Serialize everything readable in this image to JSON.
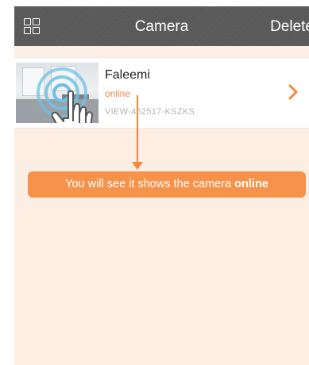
{
  "navbar": {
    "title": "Camera",
    "delete_label": "Delete",
    "menu_icon": "grid-icon"
  },
  "camera": {
    "name": "Faleemi",
    "status": "online",
    "id": "VIEW-462517-KSZKS",
    "arrow_icon": "chevron-right-icon"
  },
  "annotation": {
    "text": "You will see it shows the camera",
    "emphasis": "online"
  },
  "colors": {
    "accent": "#f4873c",
    "callout": "#f6924a",
    "navbar": "#585858",
    "background": "#fdeee4"
  }
}
